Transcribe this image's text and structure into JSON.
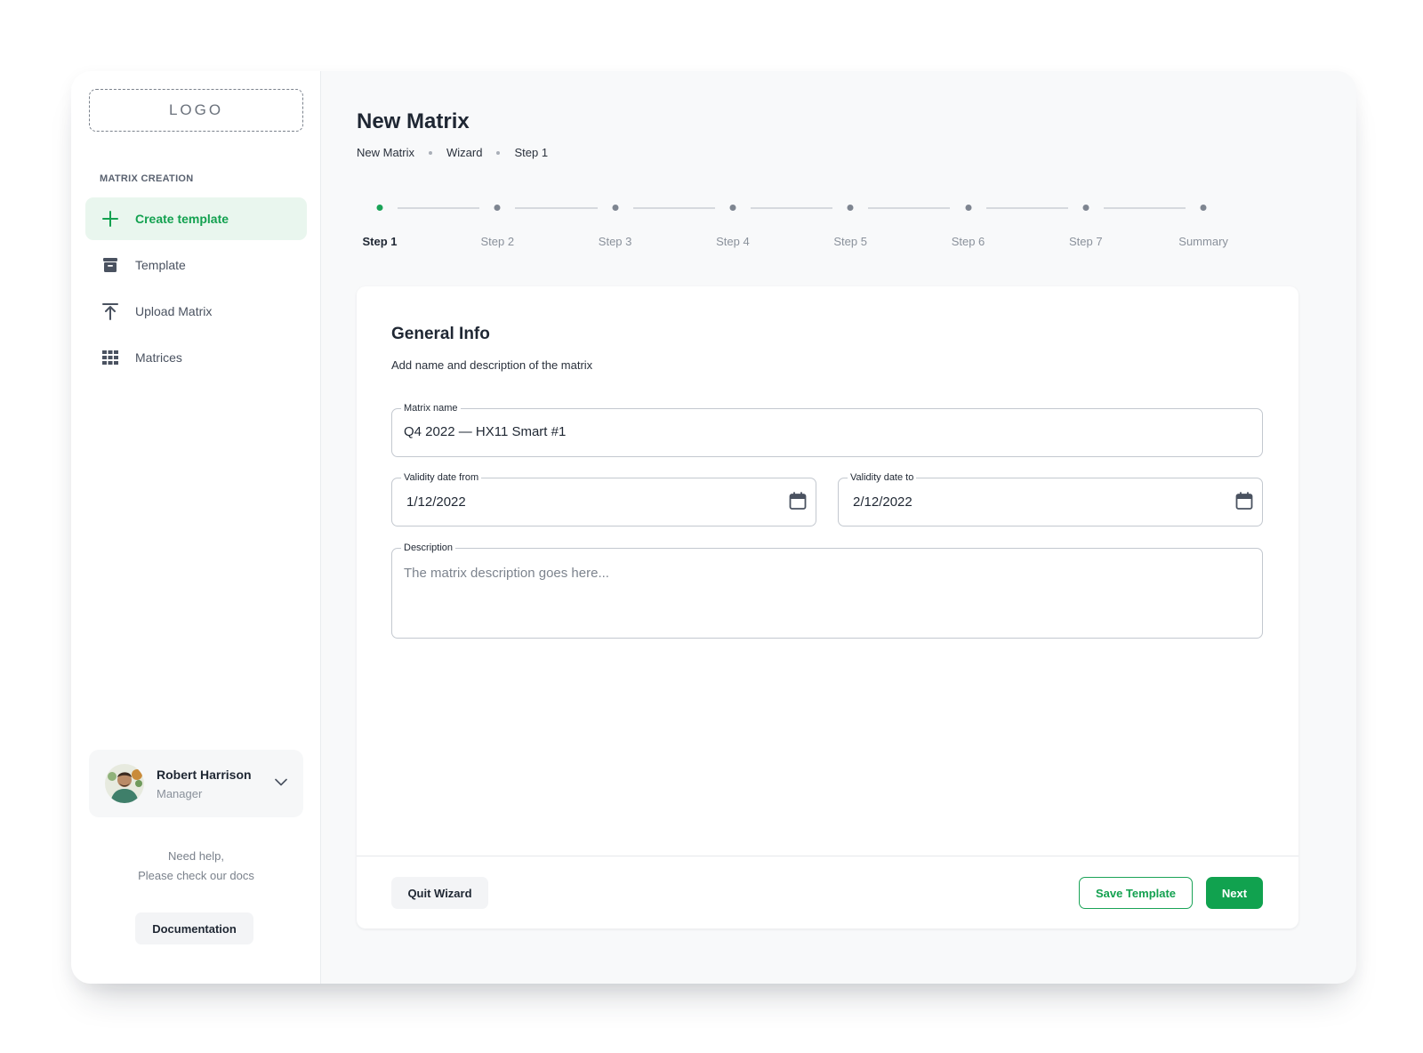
{
  "logo": {
    "text": "LOGO"
  },
  "sidebar": {
    "section_label": "MATRIX CREATION",
    "items": [
      {
        "label": "Create template",
        "icon": "plus-icon",
        "active": true
      },
      {
        "label": "Template",
        "icon": "archive-icon",
        "active": false
      },
      {
        "label": "Upload Matrix",
        "icon": "upload-icon",
        "active": false
      },
      {
        "label": "Matrices",
        "icon": "grid-icon",
        "active": false
      }
    ],
    "user": {
      "name": "Robert Harrison",
      "role": "Manager"
    },
    "help_line1": "Need help,",
    "help_line2": "Please check our docs",
    "docs_button": "Documentation"
  },
  "header": {
    "title": "New Matrix",
    "breadcrumb": [
      "New Matrix",
      "Wizard",
      "Step 1"
    ]
  },
  "stepper": {
    "steps": [
      "Step 1",
      "Step 2",
      "Step 3",
      "Step 4",
      "Step 5",
      "Step 6",
      "Step 7",
      "Summary"
    ],
    "active_index": 0
  },
  "form": {
    "title": "General Info",
    "subtitle": "Add name and description of the matrix",
    "matrix_name": {
      "label": "Matrix name",
      "value": "Q4 2022 — HX11 Smart  #1"
    },
    "date_from": {
      "label": "Validity date from",
      "value": "1/12/2022"
    },
    "date_to": {
      "label": "Validity date to",
      "value": "2/12/2022"
    },
    "description": {
      "label": "Description",
      "placeholder": "The matrix description goes here..."
    }
  },
  "footer": {
    "quit_label": "Quit Wizard",
    "save_label": "Save Template",
    "next_label": "Next"
  },
  "colors": {
    "accent": "#13a150",
    "accent_bg": "#e9f6ee",
    "text": "#1f2733",
    "muted": "#8a919b"
  }
}
